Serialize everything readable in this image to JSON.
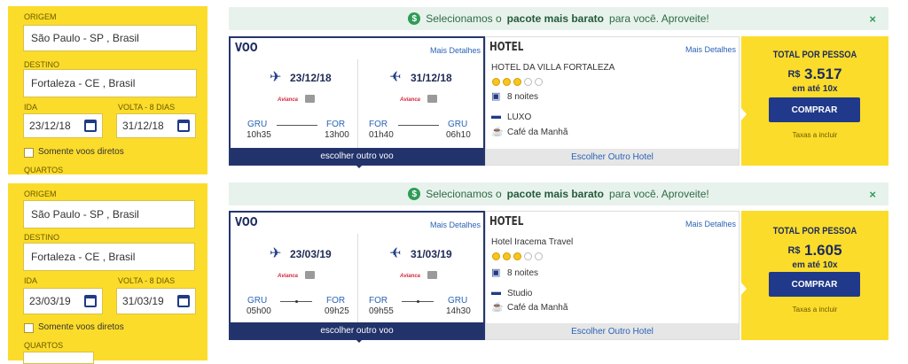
{
  "labels": {
    "origem": "ORIGEM",
    "destino": "DESTINO",
    "ida": "IDA",
    "volta": "VOLTA - 8 DIAS",
    "direct": "Somente voos diretos",
    "quartos": "QUARTOS",
    "voo": "VOO",
    "hotel": "HOTEL",
    "mais_detalhes": "Mais Detalhes",
    "escolher_voo": "escolher outro voo",
    "escolher_hotel": "Escolher Outro Hotel",
    "total": "TOTAL POR PESSOA",
    "comprar": "COMPRAR",
    "taxas": "Taxas a incluir",
    "close": "×",
    "money_icon": "$"
  },
  "banner": {
    "pre": "Selecionamos o",
    "bold": "pacote mais barato",
    "post": "para você. Aproveite!"
  },
  "packages": [
    {
      "search": {
        "origin": "São Paulo - SP , Brasil",
        "destination": "Fortaleza - CE , Brasil",
        "ida": "23/12/18",
        "volta": "31/12/18"
      },
      "outbound": {
        "date": "23/12/18",
        "airline": "Avianca",
        "from": "GRU",
        "to": "FOR",
        "dep": "10h35",
        "arr": "13h00",
        "direct": true
      },
      "inbound": {
        "date": "31/12/18",
        "airline": "Avianca",
        "from": "FOR",
        "to": "GRU",
        "dep": "01h40",
        "arr": "06h10",
        "direct": true
      },
      "hotel": {
        "name": "HOTEL DA VILLA FORTALEZA",
        "stars": 3,
        "nights": "8 noites",
        "room": "LUXO",
        "meal": "Café da Manhã"
      },
      "price": {
        "currency": "R$",
        "value": "3.517",
        "installments": "em até 10x"
      }
    },
    {
      "search": {
        "origin": "São Paulo - SP , Brasil",
        "destination": "Fortaleza - CE , Brasil",
        "ida": "23/03/19",
        "volta": "31/03/19"
      },
      "outbound": {
        "date": "23/03/19",
        "airline": "Avianca",
        "from": "GRU",
        "to": "FOR",
        "dep": "05h00",
        "arr": "09h25",
        "direct": false
      },
      "inbound": {
        "date": "31/03/19",
        "airline": "Avianca",
        "from": "FOR",
        "to": "GRU",
        "dep": "09h55",
        "arr": "14h30",
        "direct": false
      },
      "hotel": {
        "name": "Hotel Iracema Travel",
        "stars": 3,
        "nights": "8 noites",
        "room": "Studio",
        "meal": "Café da Manhã"
      },
      "price": {
        "currency": "R$",
        "value": "1.605",
        "installments": "em até 10x"
      }
    }
  ],
  "colors": {
    "yellow": "#fcdc2a",
    "navy": "#22326a",
    "green": "#2e9c57",
    "link": "#2b63b5"
  }
}
